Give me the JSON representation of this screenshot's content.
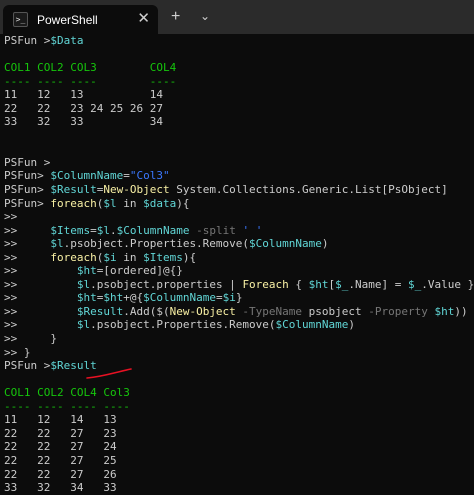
{
  "window": {
    "tab_icon": "terminal-icon",
    "tab_title": "PowerShell",
    "close_glyph": "✕",
    "new_tab_glyph": "+",
    "dropdown_glyph": "⌄"
  },
  "terminal": {
    "lines": [
      [
        {
          "c": "w",
          "t": "PSFun >"
        },
        {
          "c": "v",
          "t": "$Data"
        }
      ],
      [],
      [
        {
          "c": "g",
          "t": "COL1 COL2 COL3        COL4"
        }
      ],
      [
        {
          "c": "g",
          "t": "---- ---- ----        ----"
        }
      ],
      [
        {
          "c": "w",
          "t": "11   12   13          14"
        }
      ],
      [
        {
          "c": "w",
          "t": "22   22   23 24 25 26 27"
        }
      ],
      [
        {
          "c": "w",
          "t": "33   32   33          34"
        }
      ],
      [],
      [],
      [
        {
          "c": "w",
          "t": "PSFun >"
        }
      ],
      [
        {
          "c": "w",
          "t": "PSFun> "
        },
        {
          "c": "v",
          "t": "$ColumnName"
        },
        {
          "c": "w",
          "t": "="
        },
        {
          "c": "s",
          "t": "\"Col3\""
        }
      ],
      [
        {
          "c": "w",
          "t": "PSFun> "
        },
        {
          "c": "v",
          "t": "$Result"
        },
        {
          "c": "w",
          "t": "="
        },
        {
          "c": "y",
          "t": "New-Object"
        },
        {
          "c": "w",
          "t": " System.Collections.Generic.List[PsObject]"
        }
      ],
      [
        {
          "c": "w",
          "t": "PSFun> "
        },
        {
          "c": "y",
          "t": "foreach"
        },
        {
          "c": "w",
          "t": "("
        },
        {
          "c": "v",
          "t": "$l"
        },
        {
          "c": "w",
          "t": " in "
        },
        {
          "c": "v",
          "t": "$data"
        },
        {
          "c": "w",
          "t": "){"
        }
      ],
      [
        {
          "c": "w",
          "t": ">>"
        }
      ],
      [
        {
          "c": "w",
          "t": ">>     "
        },
        {
          "c": "v",
          "t": "$Items"
        },
        {
          "c": "w",
          "t": "="
        },
        {
          "c": "v",
          "t": "$l"
        },
        {
          "c": "w",
          "t": "."
        },
        {
          "c": "v",
          "t": "$ColumnName"
        },
        {
          "c": "gr",
          "t": " -split"
        },
        {
          "c": "s",
          "t": " ' '"
        }
      ],
      [
        {
          "c": "w",
          "t": ">>     "
        },
        {
          "c": "v",
          "t": "$l"
        },
        {
          "c": "w",
          "t": ".psobject.Properties.Remove("
        },
        {
          "c": "v",
          "t": "$ColumnName"
        },
        {
          "c": "w",
          "t": ")"
        }
      ],
      [
        {
          "c": "w",
          "t": ">>     "
        },
        {
          "c": "y",
          "t": "foreach"
        },
        {
          "c": "w",
          "t": "("
        },
        {
          "c": "v",
          "t": "$i"
        },
        {
          "c": "w",
          "t": " in "
        },
        {
          "c": "v",
          "t": "$Items"
        },
        {
          "c": "w",
          "t": "){"
        }
      ],
      [
        {
          "c": "w",
          "t": ">>         "
        },
        {
          "c": "v",
          "t": "$ht"
        },
        {
          "c": "w",
          "t": "=[ordered]@{}"
        }
      ],
      [
        {
          "c": "w",
          "t": ">>         "
        },
        {
          "c": "v",
          "t": "$l"
        },
        {
          "c": "w",
          "t": ".psobject.properties | "
        },
        {
          "c": "y",
          "t": "Foreach"
        },
        {
          "c": "w",
          "t": " { "
        },
        {
          "c": "v",
          "t": "$ht"
        },
        {
          "c": "w",
          "t": "["
        },
        {
          "c": "v",
          "t": "$_"
        },
        {
          "c": "w",
          "t": ".Name] = "
        },
        {
          "c": "v",
          "t": "$_"
        },
        {
          "c": "w",
          "t": ".Value }"
        }
      ],
      [
        {
          "c": "w",
          "t": ">>         "
        },
        {
          "c": "v",
          "t": "$ht"
        },
        {
          "c": "w",
          "t": "="
        },
        {
          "c": "v",
          "t": "$ht"
        },
        {
          "c": "w",
          "t": "+@{"
        },
        {
          "c": "v",
          "t": "$ColumnName"
        },
        {
          "c": "w",
          "t": "="
        },
        {
          "c": "v",
          "t": "$i"
        },
        {
          "c": "w",
          "t": "}"
        }
      ],
      [
        {
          "c": "w",
          "t": ">>         "
        },
        {
          "c": "v",
          "t": "$Result"
        },
        {
          "c": "w",
          "t": ".Add($("
        },
        {
          "c": "y",
          "t": "New-Object"
        },
        {
          "c": "gr",
          "t": " -TypeName"
        },
        {
          "c": "w",
          "t": " psobject "
        },
        {
          "c": "gr",
          "t": "-Property"
        },
        {
          "c": "w",
          "t": " "
        },
        {
          "c": "v",
          "t": "$ht"
        },
        {
          "c": "w",
          "t": "))"
        }
      ],
      [
        {
          "c": "w",
          "t": ">>         "
        },
        {
          "c": "v",
          "t": "$l"
        },
        {
          "c": "w",
          "t": ".psobject.Properties.Remove("
        },
        {
          "c": "v",
          "t": "$ColumnName"
        },
        {
          "c": "w",
          "t": ")"
        }
      ],
      [
        {
          "c": "w",
          "t": ">>     }"
        }
      ],
      [
        {
          "c": "w",
          "t": ">> }"
        }
      ],
      [
        {
          "c": "w",
          "t": "PSFun >"
        },
        {
          "c": "v",
          "t": "$Result"
        }
      ],
      [],
      [
        {
          "c": "g",
          "t": "COL1 COL2 COL4 Col3"
        }
      ],
      [
        {
          "c": "g",
          "t": "---- ---- ---- ----"
        }
      ],
      [
        {
          "c": "w",
          "t": "11   12   14   13"
        }
      ],
      [
        {
          "c": "w",
          "t": "22   22   27   23"
        }
      ],
      [
        {
          "c": "w",
          "t": "22   22   27   24"
        }
      ],
      [
        {
          "c": "w",
          "t": "22   22   27   25"
        }
      ],
      [
        {
          "c": "w",
          "t": "22   22   27   26"
        }
      ],
      [
        {
          "c": "w",
          "t": "33   32   34   33"
        }
      ]
    ]
  },
  "annotation": {
    "color": "#e81123"
  }
}
